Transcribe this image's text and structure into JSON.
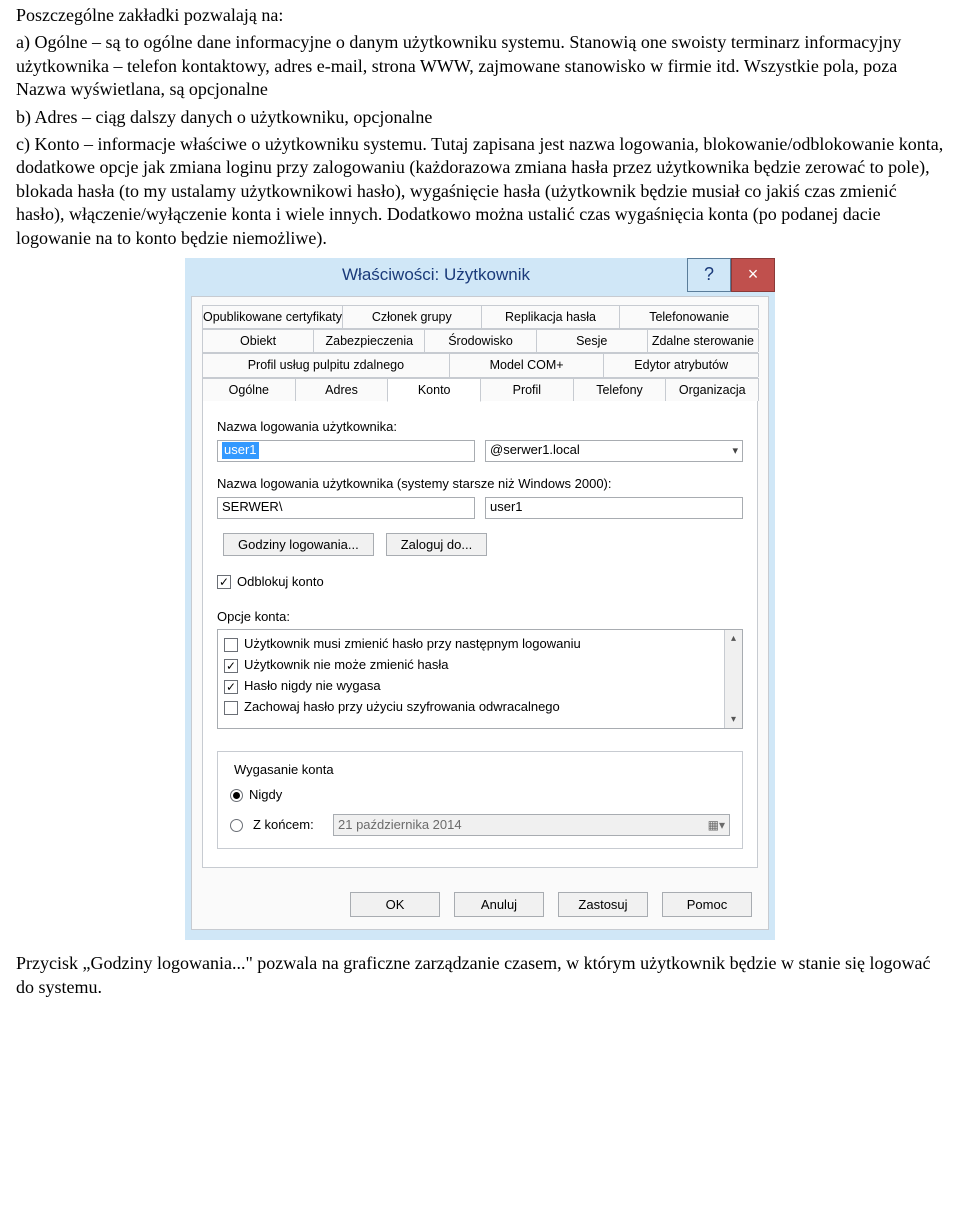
{
  "doc": {
    "p1": "Poszczególne zakładki pozwalają na:",
    "p2": "a) Ogólne – są to ogólne dane informacyjne o danym użytkowniku systemu. Stanowią one swoisty terminarz informacyjny użytkownika – telefon kontaktowy, adres e-mail,  strona WWW, zajmowane stanowisko w firmie itd.  Wszystkie pola, poza Nazwa wyświetlana, są opcjonalne",
    "p3": "b) Adres – ciąg dalszy danych o użytkowniku, opcjonalne",
    "p4": "c) Konto – informacje właściwe o użytkowniku systemu. Tutaj zapisana jest nazwa logowania, blokowanie/odblokowanie konta, dodatkowe opcje jak zmiana loginu przy zalogowaniu (każdorazowa zmiana hasła przez użytkownika będzie zerować to pole), blokada hasła (to my ustalamy użytkownikowi hasło), wygaśnięcie hasła (użytkownik będzie musiał co jakiś czas zmienić hasło), włączenie/wyłączenie konta i wiele innych. Dodatkowo można ustalić czas wygaśnięcia konta (po podanej dacie logowanie na to konto będzie niemożliwe).",
    "p5": "Przycisk „Godziny logowania...\" pozwala na graficzne zarządzanie czasem, w którym użytkownik będzie w stanie się logować do systemu."
  },
  "dialog": {
    "title": "Właściwości: Użytkownik",
    "help": "?",
    "close": "×",
    "tabs": {
      "r1": [
        "Opublikowane certyfikaty",
        "Członek grupy",
        "Replikacja hasła",
        "Telefonowanie"
      ],
      "r2": [
        "Obiekt",
        "Zabezpieczenia",
        "Środowisko",
        "Sesje",
        "Zdalne sterowanie"
      ],
      "r3": [
        "Profil usług pulpitu zdalnego",
        "Model COM+",
        "Edytor atrybutów"
      ],
      "r4": [
        "Ogólne",
        "Adres",
        "Konto",
        "Profil",
        "Telefony",
        "Organizacja"
      ]
    },
    "labels": {
      "login": "Nazwa logowania użytkownika:",
      "login_old": "Nazwa logowania użytkownika (systemy starsze niż Windows 2000):",
      "acct_opts": "Opcje konta:",
      "expire": "Wygasanie konta"
    },
    "values": {
      "user": "user1",
      "domain_suffix": "@serwer1.local",
      "domain_prefix": "SERWER\\",
      "user2": "user1",
      "expire_date": "21 października 2014"
    },
    "buttons": {
      "hours": "Godziny logowania...",
      "logon_to": "Zaloguj do...",
      "ok": "OK",
      "cancel": "Anuluj",
      "apply": "Zastosuj",
      "help": "Pomoc"
    },
    "unlock": "Odblokuj konto",
    "options": [
      {
        "label": "Użytkownik musi zmienić hasło przy następnym logowaniu",
        "checked": false
      },
      {
        "label": "Użytkownik nie może zmienić hasła",
        "checked": true
      },
      {
        "label": "Hasło nigdy nie wygasa",
        "checked": true
      },
      {
        "label": "Zachowaj hasło przy użyciu szyfrowania odwracalnego",
        "checked": false
      }
    ],
    "expire_opts": {
      "never": "Nigdy",
      "end": "Z końcem:"
    }
  }
}
